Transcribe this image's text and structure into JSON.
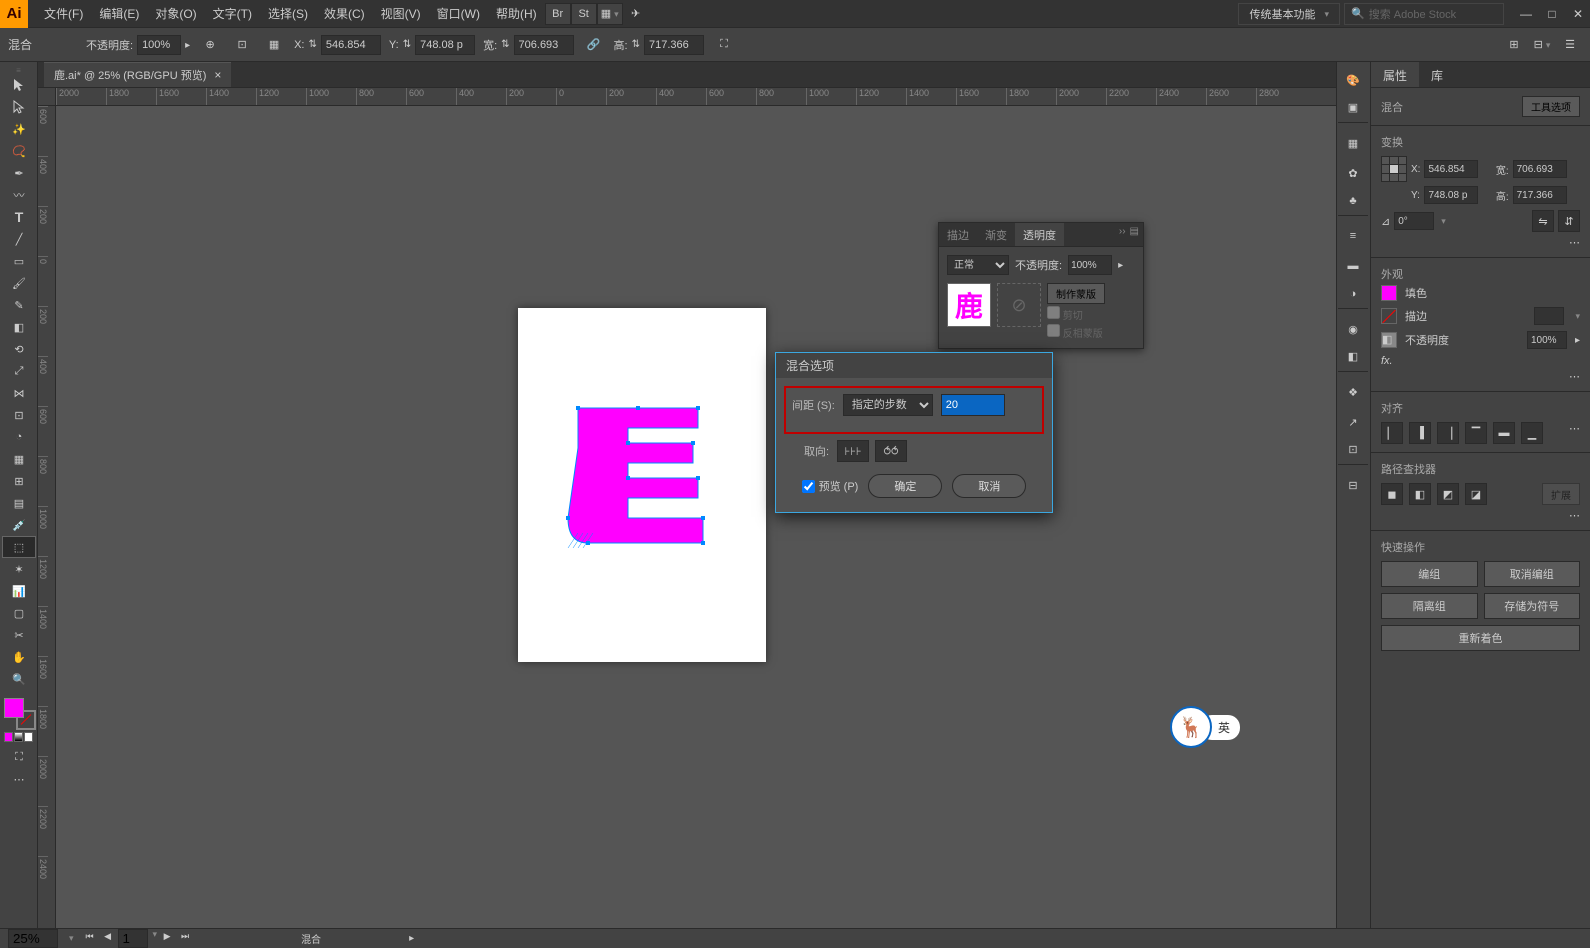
{
  "menubar": {
    "items": [
      "文件(F)",
      "编辑(E)",
      "对象(O)",
      "文字(T)",
      "选择(S)",
      "效果(C)",
      "视图(V)",
      "窗口(W)",
      "帮助(H)"
    ],
    "bridge": "Br",
    "stock": "St",
    "workspace": "传统基本功能",
    "search_placeholder": "搜索 Adobe Stock"
  },
  "optionsbar": {
    "tool_label": "混合",
    "opacity_label": "不透明度:",
    "opacity_value": "100%",
    "x_label": "X:",
    "x_value": "546.854",
    "y_label": "Y:",
    "y_value": "748.08 p",
    "w_label": "宽:",
    "w_value": "706.693",
    "h_label": "高:",
    "h_value": "717.366"
  },
  "document": {
    "tab_title": "鹿.ai* @ 25% (RGB/GPU 预览)",
    "ruler_h": [
      "2000",
      "1800",
      "1600",
      "1400",
      "1200",
      "1000",
      "800",
      "600",
      "400",
      "200",
      "0",
      "200",
      "400",
      "600",
      "800",
      "1000",
      "1200",
      "1400",
      "1600",
      "1800",
      "2000",
      "2200",
      "2400",
      "2600",
      "2800"
    ],
    "ruler_v": [
      "600",
      "400",
      "200",
      "0",
      "200",
      "400",
      "600",
      "800",
      "1000",
      "1200",
      "1400",
      "1600",
      "1800",
      "2000",
      "2200",
      "2400"
    ]
  },
  "properties": {
    "tab_props": "属性",
    "tab_libs": "库",
    "selection": "混合",
    "tool_options": "工具选项",
    "transform_label": "变换",
    "x_label": "X:",
    "x_value": "546.854",
    "y_label": "Y:",
    "y_value": "748.08 p",
    "w_label": "宽:",
    "w_value": "706.693",
    "h_label": "高:",
    "h_value": "717.366",
    "rotate_label": "⊿",
    "rotate_value": "0°",
    "appearance_label": "外观",
    "fill_label": "填色",
    "stroke_label": "描边",
    "opacity_label": "不透明度",
    "opacity_value": "100%",
    "fx_label": "fx.",
    "align_label": "对齐",
    "pathfinder_label": "路径查找器",
    "pf_expand": "扩展",
    "quick_label": "快速操作",
    "btn_group": "编组",
    "btn_ungroup": "取消编组",
    "btn_isolate": "隔离组",
    "btn_savesymbol": "存储为符号",
    "btn_recolor": "重新着色"
  },
  "transparency": {
    "tab_stroke": "描边",
    "tab_grad": "渐变",
    "tab_trans": "透明度",
    "mode": "正常",
    "opacity_label": "不透明度:",
    "opacity_value": "100%",
    "make_mask": "制作蒙版",
    "clip": "剪切",
    "invert": "反相蒙版",
    "thumb_char": "鹿"
  },
  "blend_dialog": {
    "title": "混合选项",
    "spacing_label": "间距 (S):",
    "spacing_mode": "指定的步数",
    "spacing_value": "20",
    "orient_label": "取向:",
    "preview": "预览 (P)",
    "ok": "确定",
    "cancel": "取消"
  },
  "statusbar": {
    "zoom": "25%",
    "page": "1",
    "tool": "混合"
  },
  "ime": {
    "lang": "英",
    "icon": "🦌"
  }
}
